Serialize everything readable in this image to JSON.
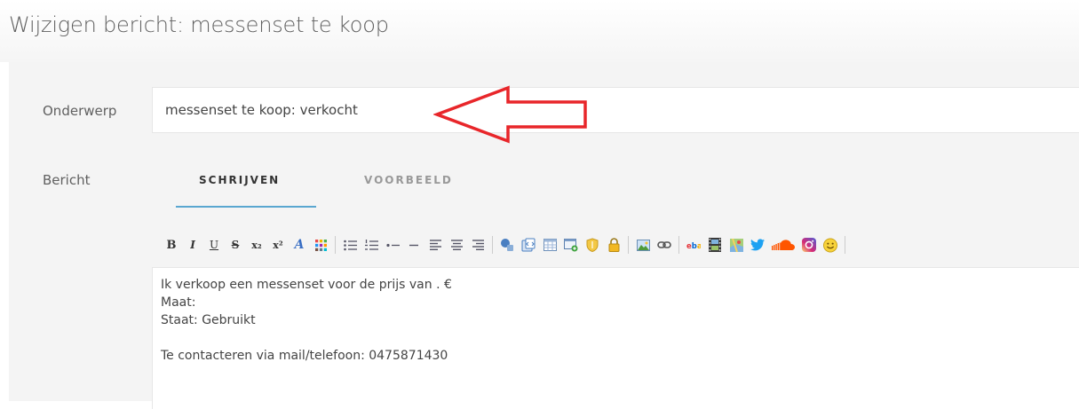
{
  "page": {
    "title": "Wijzigen bericht: messenset te koop"
  },
  "form": {
    "subject_label": "Onderwerp",
    "subject_value": "messenset te koop: verkocht",
    "message_label": "Bericht"
  },
  "tabs": [
    {
      "label": "SCHRIJVEN",
      "active": true
    },
    {
      "label": "VOORBEELD",
      "active": false
    }
  ],
  "toolbar": {
    "bold_glyph": "B",
    "italic_glyph": "I",
    "underline_glyph": "U",
    "strike_glyph": "S",
    "subscript_glyph": "x₂",
    "superscript_glyph": "x²",
    "font_glyph": "A",
    "buttons": [
      "bold-icon",
      "italic-icon",
      "underline-icon",
      "strikethrough-icon",
      "subscript-icon",
      "superscript-icon",
      "font-color-icon",
      "color-grid-icon",
      "bullet-list-icon",
      "numbered-list-icon",
      "list-item-icon",
      "horizontal-rule-icon",
      "align-left-icon",
      "align-center-icon",
      "align-right-icon",
      "quote-icon",
      "code-icon",
      "table-icon",
      "spoiler-icon",
      "shield-icon",
      "lock-icon",
      "image-icon",
      "link-icon",
      "ebay-icon",
      "film-icon",
      "map-icon",
      "twitter-icon",
      "soundcloud-icon",
      "instagram-icon",
      "smiley-icon"
    ]
  },
  "editor": {
    "lines": [
      "Ik verkoop een messenset voor de prijs van . €",
      "Maat:",
      "Staat: Gebruikt",
      "",
      "Te contacteren via mail/telefoon: 0475871430"
    ]
  },
  "annotation": {
    "arrow_color": "#e8262a"
  },
  "colors": {
    "accent": "#5aa7d0",
    "twitter": "#1da1f2",
    "soundcloud": "#ff5500",
    "instagram": "#c13584"
  }
}
